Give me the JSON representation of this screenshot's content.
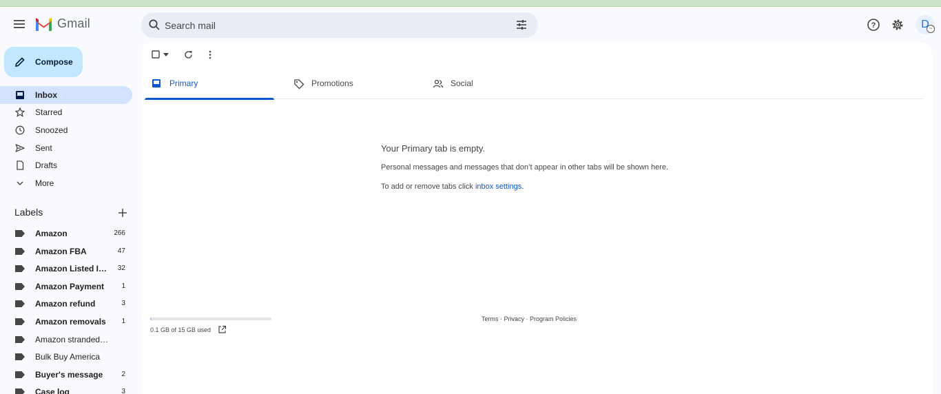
{
  "app": {
    "name": "Gmail"
  },
  "search": {
    "placeholder": "Search mail"
  },
  "compose": {
    "label": "Compose"
  },
  "nav": [
    {
      "label": "Inbox",
      "icon": "inbox-icon",
      "active": true
    },
    {
      "label": "Starred",
      "icon": "star-icon"
    },
    {
      "label": "Snoozed",
      "icon": "clock-icon"
    },
    {
      "label": "Sent",
      "icon": "send-icon"
    },
    {
      "label": "Drafts",
      "icon": "draft-icon"
    },
    {
      "label": "More",
      "icon": "chevron-down-icon"
    }
  ],
  "labels": {
    "title": "Labels",
    "items": [
      {
        "name": "Amazon",
        "count": "266",
        "bold": true
      },
      {
        "name": "Amazon FBA",
        "count": "47",
        "bold": true
      },
      {
        "name": "Amazon Listed Items",
        "count": "32",
        "bold": true
      },
      {
        "name": "Amazon Payment",
        "count": "1",
        "bold": true
      },
      {
        "name": "Amazon refund",
        "count": "3",
        "bold": true
      },
      {
        "name": "Amazon removals",
        "count": "1",
        "bold": true
      },
      {
        "name": "Amazon stranded inventory",
        "count": "",
        "bold": false
      },
      {
        "name": "Bulk Buy America",
        "count": "",
        "bold": false
      },
      {
        "name": "Buyer's message",
        "count": "2",
        "bold": true
      },
      {
        "name": "Case log",
        "count": "3",
        "bold": true
      }
    ]
  },
  "tabs": [
    {
      "label": "Primary",
      "icon": "inbox-tab-icon",
      "active": true
    },
    {
      "label": "Promotions",
      "icon": "tag-icon"
    },
    {
      "label": "Social",
      "icon": "people-icon"
    }
  ],
  "empty": {
    "title": "Your Primary tab is empty.",
    "line1": "Personal messages and messages that don’t appear in other tabs will be shown here.",
    "line2_prefix": "To add or remove tabs click ",
    "line2_link": "inbox settings",
    "line2_suffix": "."
  },
  "storage": {
    "text": "0.1 GB of 15 GB used",
    "used_fraction": 0.0067
  },
  "footer": {
    "terms": "Terms",
    "sep": " · ",
    "privacy": "Privacy",
    "policies": "Program Policies"
  },
  "avatar": {
    "initial": "D"
  },
  "colors": {
    "accent": "#0b57d0",
    "compose_bg": "#c2e7ff",
    "active_nav": "#d3e3fd"
  }
}
